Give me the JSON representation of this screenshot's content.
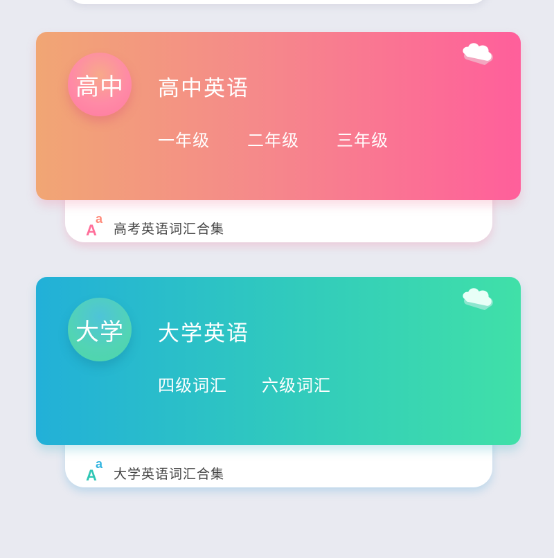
{
  "cards": {
    "high_school": {
      "badge": "高中",
      "title": "高中英语",
      "grades": [
        "一年级",
        "二年级",
        "三年级"
      ],
      "collection_label": "高考英语词汇合集"
    },
    "university": {
      "badge": "大学",
      "title": "大学英语",
      "grades": [
        "四级词汇",
        "六级词汇"
      ],
      "collection_label": "大学英语词汇合集"
    }
  },
  "aa_icon": {
    "big": "A",
    "small": "a"
  },
  "icons": [
    "cloud-icon",
    "aa-icon"
  ],
  "colors": {
    "background": "#e9eaf1",
    "high_school_gradient": [
      "#f1a674",
      "#ff5f9b"
    ],
    "university_gradient": [
      "#22b0d8",
      "#40e0a8"
    ]
  }
}
